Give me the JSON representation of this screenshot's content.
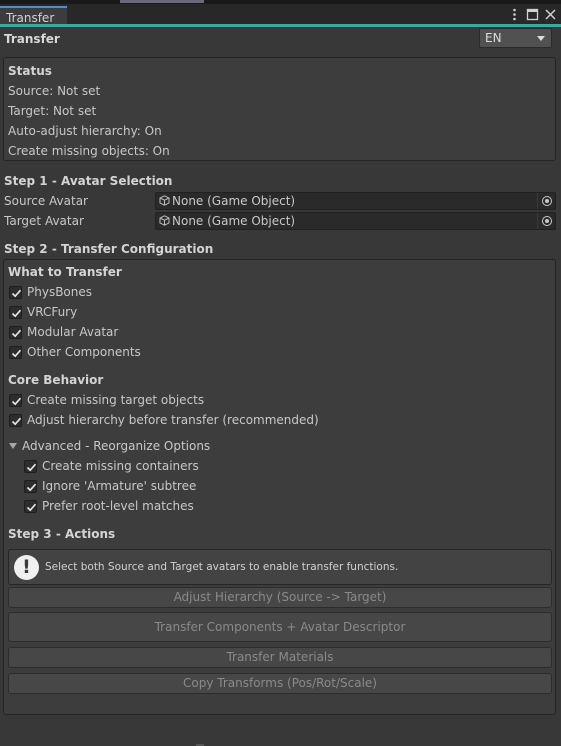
{
  "tab": {
    "title": "Transfer"
  },
  "header": {
    "title": "Transfer",
    "language": "EN"
  },
  "status": {
    "title": "Status",
    "source": "Source: Not set",
    "target": "Target: Not set",
    "auto_adjust": "Auto-adjust hierarchy: On",
    "create_missing": "Create missing objects: On"
  },
  "step1": {
    "title": "Step 1 - Avatar Selection",
    "source_label": "Source Avatar",
    "source_value": "None (Game Object)",
    "target_label": "Target Avatar",
    "target_value": "None (Game Object)"
  },
  "step2": {
    "title": "Step 2 - Transfer Configuration",
    "what_title": "What to Transfer",
    "what_items": [
      {
        "label": "PhysBones",
        "checked": true
      },
      {
        "label": "VRCFury",
        "checked": true
      },
      {
        "label": "Modular Avatar",
        "checked": true
      },
      {
        "label": "Other Components",
        "checked": true
      }
    ],
    "core_title": "Core Behavior",
    "core_items": [
      {
        "label": "Create missing target objects",
        "checked": true
      },
      {
        "label": "Adjust hierarchy before transfer (recommended)",
        "checked": true
      }
    ],
    "advanced_title": "Advanced - Reorganize Options",
    "advanced_items": [
      {
        "label": "Create missing containers",
        "checked": true
      },
      {
        "label": "Ignore 'Armature' subtree",
        "checked": true
      },
      {
        "label": "Prefer root-level matches",
        "checked": true
      }
    ]
  },
  "step3": {
    "title": "Step 3 - Actions",
    "help": "Select both Source and Target avatars to enable transfer functions.",
    "buttons": [
      "Adjust Hierarchy (Source -> Target)",
      "Transfer Components + Avatar Descriptor",
      "Transfer Materials",
      "Copy Transforms (Pos/Rot/Scale)"
    ]
  }
}
